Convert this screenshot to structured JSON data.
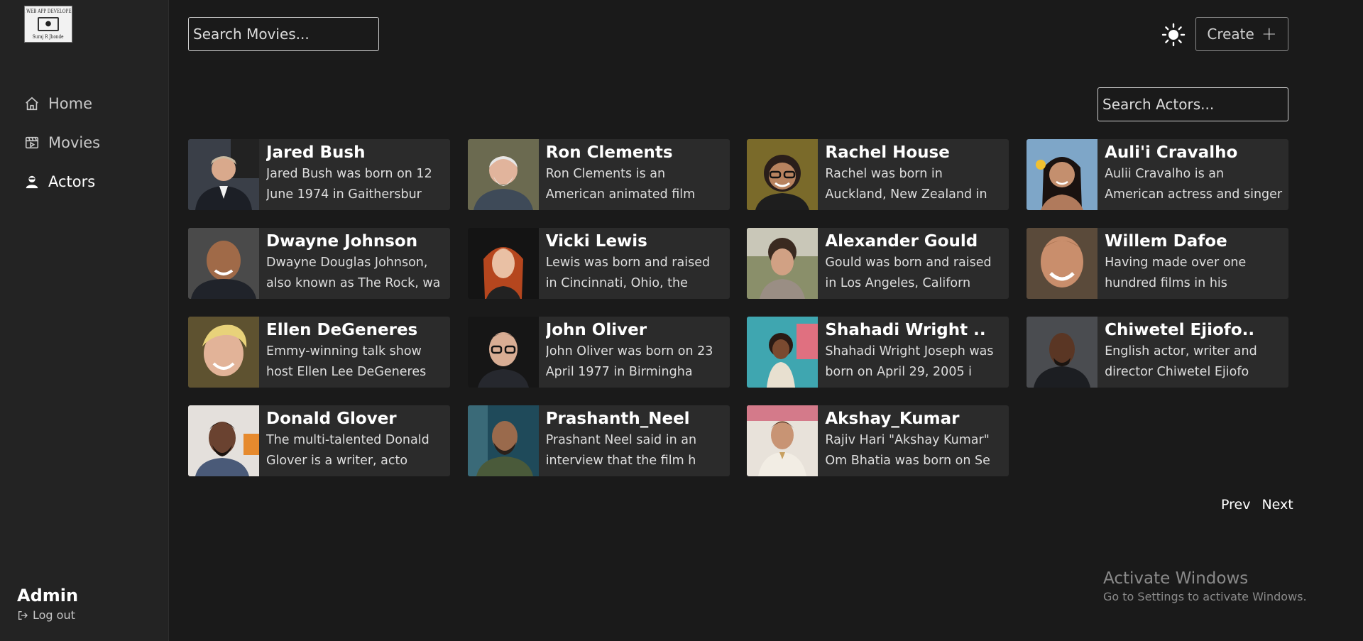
{
  "logo": {
    "top_text": "A WEB APP DEVELOPER",
    "bottom_text": "Suraj R Jhonde"
  },
  "sidebar": {
    "items": [
      {
        "label": "Home",
        "icon": "home-icon",
        "active": false
      },
      {
        "label": "Movies",
        "icon": "film-icon",
        "active": false
      },
      {
        "label": "Actors",
        "icon": "actor-icon",
        "active": true
      }
    ]
  },
  "user": {
    "name": "Admin",
    "logout_label": "Log out"
  },
  "header": {
    "search_movies_placeholder": "Search Movies...",
    "create_label": "Create",
    "create_icon": "plus-icon",
    "theme_icon": "sun-icon"
  },
  "actors_search_placeholder": "Search Actors...",
  "actors": [
    {
      "name": "Jared Bush",
      "description": "Jared Bush was born on 12 June 1974 in Gaithersbur"
    },
    {
      "name": "Ron Clements",
      "description": "Ron Clements is an American animated film"
    },
    {
      "name": "Rachel House",
      "description": "Rachel was born in Auckland, New Zealand in"
    },
    {
      "name": "Auli'i Cravalho",
      "description": "Aulii Cravalho is an American actress and singer"
    },
    {
      "name": "Dwayne Johnson",
      "description": "Dwayne Douglas Johnson, also known as The Rock, wa"
    },
    {
      "name": "Vicki Lewis",
      "description": "Lewis was born and raised in Cincinnati, Ohio, the"
    },
    {
      "name": "Alexander Gould",
      "description": "Gould was born and raised in Los Angeles, Californ"
    },
    {
      "name": "Willem Dafoe",
      "description": "Having made over one hundred films in his"
    },
    {
      "name": "Ellen DeGeneres",
      "description": "Emmy-winning talk show host Ellen Lee DeGeneres"
    },
    {
      "name": "John Oliver",
      "description": "John Oliver was born on 23 April 1977 in Birmingha"
    },
    {
      "name": "Shahadi Wright ..",
      "description": "Shahadi Wright Joseph was born on April 29, 2005 i"
    },
    {
      "name": "Chiwetel Ejiofo..",
      "description": "English actor, writer and director Chiwetel Ejiofo"
    },
    {
      "name": "Donald Glover",
      "description": "The multi-talented Donald Glover is a writer, acto"
    },
    {
      "name": "Prashanth_Neel",
      "description": "Prashant Neel said in an interview that the film h"
    },
    {
      "name": "Akshay_Kumar",
      "description": "Rajiv Hari \"Akshay Kumar\" Om Bhatia was born on Se"
    }
  ],
  "pagination": {
    "prev_label": "Prev",
    "next_label": "Next"
  },
  "watermark": {
    "title": "Activate Windows",
    "subtitle": "Go to Settings to activate Windows."
  },
  "colors": {
    "background": "#1a1a1a",
    "sidebar": "#232323",
    "card": "#2b2b2b",
    "text": "#ffffff"
  }
}
